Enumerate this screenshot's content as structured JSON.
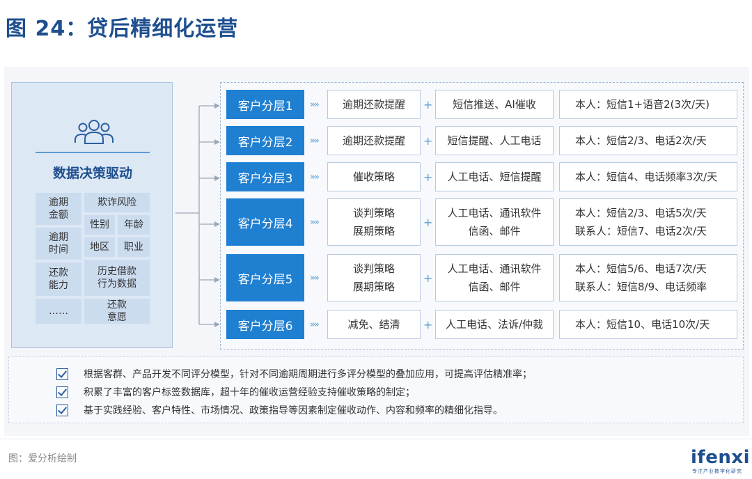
{
  "figure": {
    "title": "图 24：贷后精细化运营"
  },
  "left_panel": {
    "heading": "数据决策驱动",
    "tags": [
      "逾期\n金额",
      "欺诈风险",
      "性别",
      "年龄",
      "逾期\n时间",
      "地区",
      "职业",
      "还款\n能力",
      "历史借款\n行为数据",
      "……",
      "还款\n意愿"
    ]
  },
  "rows": [
    {
      "segment": "客户分层1",
      "chevron": "»»",
      "strategy": [
        "逾期还款提醒"
      ],
      "plus": "+",
      "channel": [
        "短信推送、AI催收"
      ],
      "frequency": [
        "本人：短信1+语音2(3次/天)"
      ]
    },
    {
      "segment": "客户分层2",
      "chevron": "»»",
      "strategy": [
        "逾期还款提醒"
      ],
      "plus": "+",
      "channel": [
        "短信提醒、人工电话"
      ],
      "frequency": [
        "本人：短信2/3、电话2次/天"
      ]
    },
    {
      "segment": "客户分层3",
      "chevron": "»»",
      "strategy": [
        "催收策略"
      ],
      "plus": "+",
      "channel": [
        "人工电话、短信提醒"
      ],
      "frequency": [
        "本人：短信4、电话频率3次/天"
      ]
    },
    {
      "segment": "客户分层4",
      "chevron": "»»",
      "strategy": [
        "谈判策略",
        "展期策略"
      ],
      "plus": "+",
      "channel": [
        "人工电话、通讯软件",
        "信函、邮件"
      ],
      "frequency": [
        "本人：短信2/3、电话5次/天",
        "联系人：短信7、电话2次/天"
      ]
    },
    {
      "segment": "客户分层5",
      "chevron": "»»",
      "strategy": [
        "谈判策略",
        "展期策略"
      ],
      "plus": "+",
      "channel": [
        "人工电话、通讯软件",
        "信函、邮件"
      ],
      "frequency": [
        "本人：短信5/6、电话7次/天",
        "联系人：短信8/9、电话频率"
      ]
    },
    {
      "segment": "客户分层6",
      "chevron": "»»",
      "strategy": [
        "减免、结清"
      ],
      "plus": "+",
      "channel": [
        "人工电话、法诉/仲裁"
      ],
      "frequency": [
        "本人：短信10、电话10次/天"
      ]
    }
  ],
  "notes": [
    "根据客群、产品开发不同评分模型，针对不同逾期周期进行多评分模型的叠加应用，可提高评估精准率；",
    "积累了丰富的客户标签数据库，超十年的催收运营经验支持催收策略的制定；",
    "基于实践经验、客户特性、市场情况、政策指导等因素制定催收动作、内容和频率的精细化指导。"
  ],
  "source": "图：爱分析绘制",
  "logo": {
    "name": "ifenxi",
    "tagline": "专注产业数字化研究"
  },
  "colors": {
    "accent": "#1f7fd1",
    "title": "#1e4f8f",
    "tag_bg": "#ccdcef",
    "panel_bg": "#dde8f5"
  }
}
